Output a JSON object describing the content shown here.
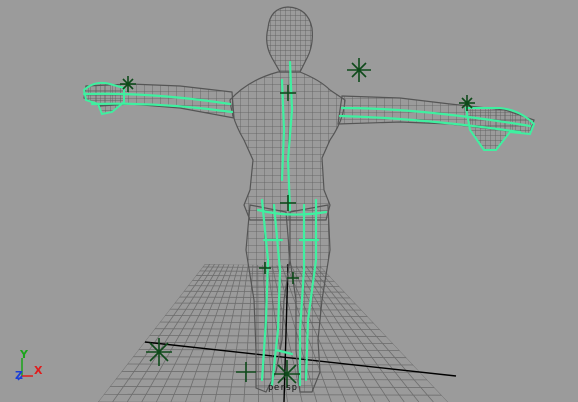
{
  "viewport": {
    "camera_name": "persp",
    "background": "#9b9b9b"
  },
  "axis_indicator": {
    "x_label": "X",
    "y_label": "Y",
    "z_label": "Z",
    "x_color": "#e01c1c",
    "y_color": "#1aa51a",
    "z_color": "#1c3fd6"
  },
  "model": {
    "wireframe_color": "#5c5c5c",
    "selected_color": "#3ff0a0",
    "joint_color": "#0e4a1a"
  },
  "grid": {
    "line_color": "#6e6e6e",
    "axis_line_color": "#000000"
  }
}
